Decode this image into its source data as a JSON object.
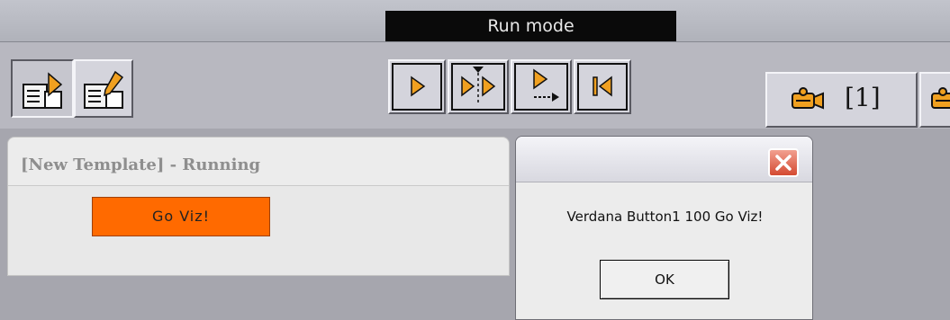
{
  "header": {
    "mode_label": "Run mode"
  },
  "toolbar": {
    "left_buttons": [
      {
        "icon": "run-template-icon",
        "state": "pressed"
      },
      {
        "icon": "edit-template-icon",
        "state": "normal"
      }
    ],
    "playback_buttons": [
      {
        "icon": "play-icon"
      },
      {
        "icon": "step-play-icon"
      },
      {
        "icon": "play-next-icon"
      },
      {
        "icon": "rewind-to-start-icon"
      }
    ],
    "camera_button": {
      "icon": "camera-icon",
      "label": "[1]"
    }
  },
  "template_panel": {
    "title": "[New Template] - Running",
    "button_label": "Go Viz!"
  },
  "dialog": {
    "message": "Verdana Button1 100 Go Viz!",
    "ok_label": "OK"
  },
  "colors": {
    "accent_orange": "#ff6a00",
    "icon_orange": "#f0a020",
    "mode_tab_bg": "#0a0a0a",
    "close_red": "#d44a32"
  }
}
